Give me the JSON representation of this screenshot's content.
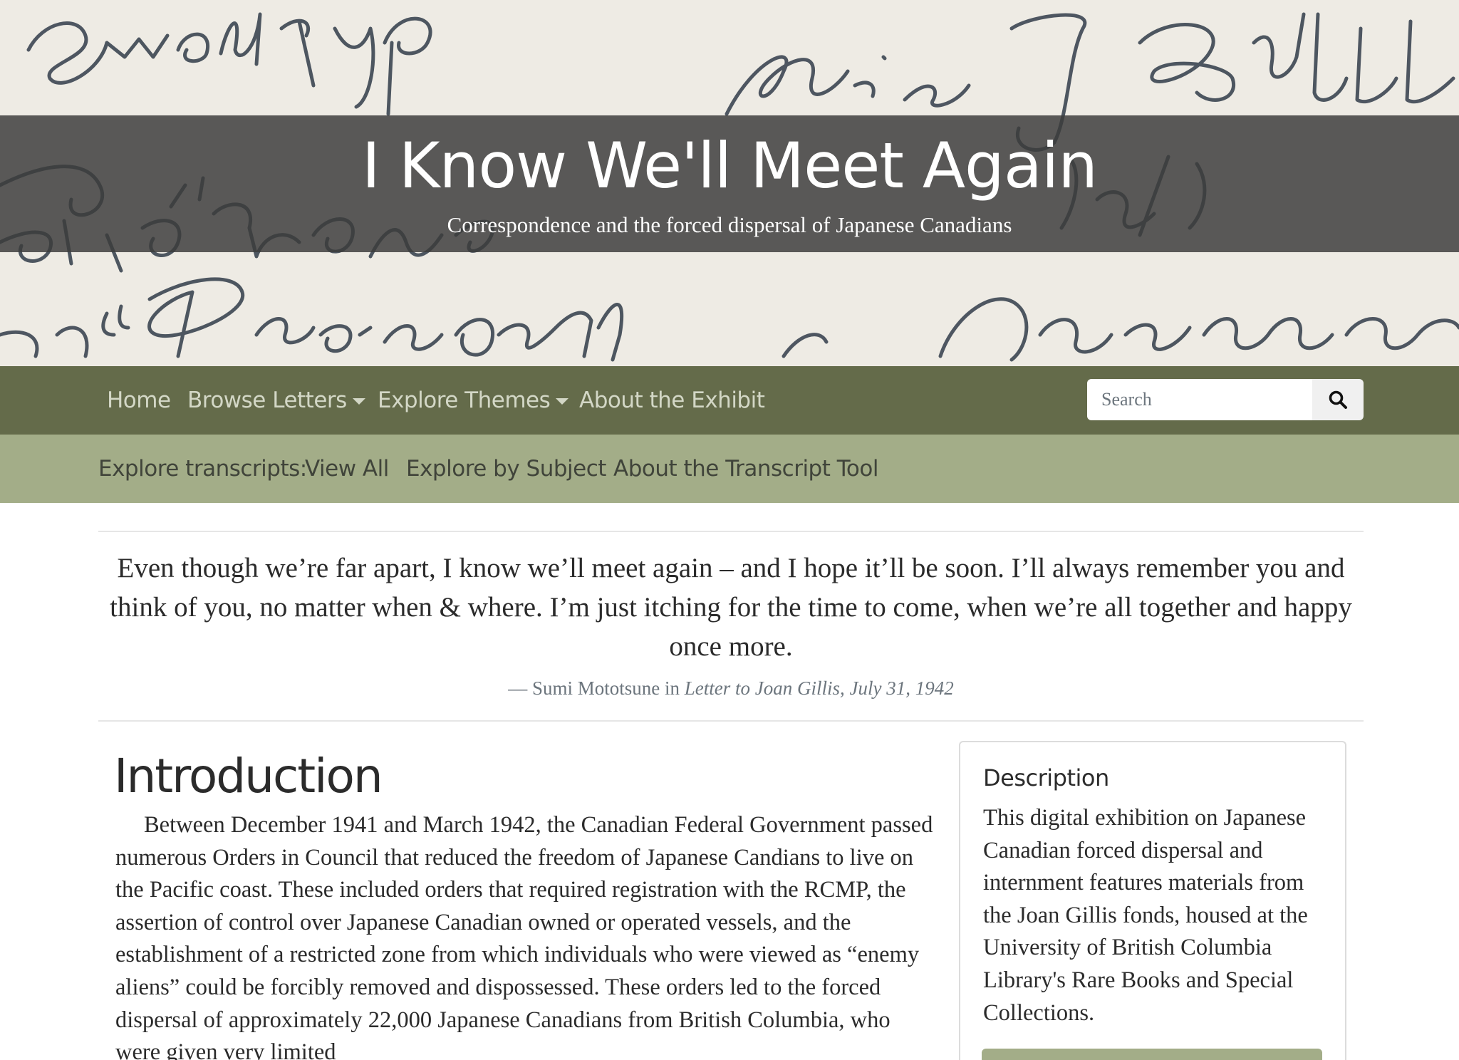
{
  "hero": {
    "title": "I Know We'll Meet Again",
    "subtitle": "Correspondence and the forced dispersal of Japanese Canadians"
  },
  "nav": {
    "home": "Home",
    "browse_letters": "Browse Letters",
    "explore_themes": "Explore Themes",
    "about_exhibit": "About the Exhibit",
    "search_placeholder": "Search",
    "search_icon": "search-icon"
  },
  "subnav": {
    "prefix": "Explore transcripts:",
    "view_all": "View All",
    "explore_subject": "Explore by Subject",
    "about_tool": "About the Transcript Tool"
  },
  "quote": {
    "text": "Even though we’re far apart, I know we’ll meet again – and I hope it’ll be soon. I’ll always remember you and think of you, no matter when & where. I’m just itching for the time to come, when we’re all together and happy once more.",
    "attribution_prefix": "— Sumi Mototsune in",
    "source": "Letter to Joan Gillis, July 31, 1942"
  },
  "introduction": {
    "heading": "Introduction",
    "body": "Between December 1941 and March 1942, the Canadian Federal Government passed numerous Orders in Council that reduced the freedom of Japanese Candians to live on the Pacific coast. These included orders that required registration with the RCMP, the assertion of control over Japanese Canadian owned or operated vessels, and the establishment of a restricted zone from which individuals who were viewed as “enemy aliens” could be forcibly removed and dispossessed. These orders led to the forced dispersal of approximately 22,000 Japanese Canadians from British Columbia, who were given very limited"
  },
  "description": {
    "heading": "Description",
    "body": "This digital exhibition on Japanese Canadian forced dispersal and internment features materials from the Joan Gillis fonds, housed at the University of British Columbia Library's Rare Books and Special Collections."
  },
  "colors": {
    "nav_bg": "#646b4a",
    "subnav_bg": "#a3ad88",
    "hero_band": "#3c3c3c",
    "text": "#2b2b2b"
  }
}
